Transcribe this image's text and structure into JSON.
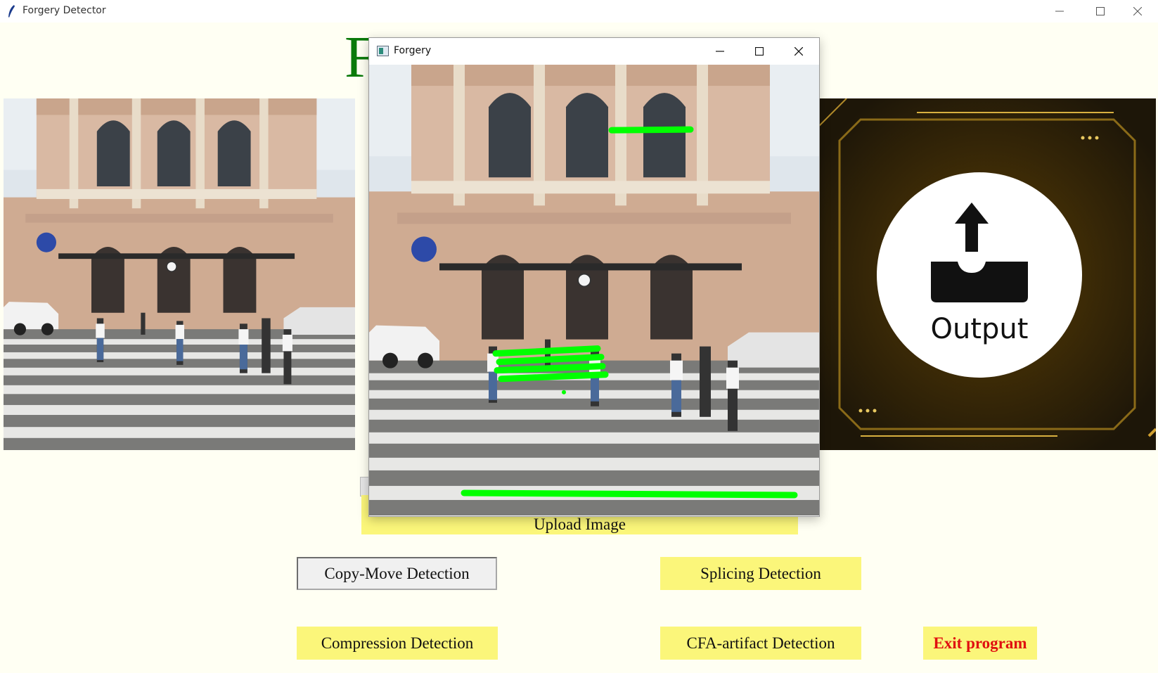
{
  "window": {
    "title": "Forgery Detector"
  },
  "heading": {
    "visible_letter": "F"
  },
  "output_panel": {
    "label": "Output"
  },
  "popup": {
    "title": "Forgery"
  },
  "buttons": {
    "upload": "Upload Image",
    "copy_move": "Copy-Move Detection",
    "splicing": "Splicing Detection",
    "compression": "Compression Detection",
    "cfa": "CFA-artifact Detection",
    "exit": "Exit program"
  },
  "colors": {
    "background": "#fffff3",
    "button_yellow": "#fbf67a",
    "exit_text": "#e01010",
    "heading_green": "#0a7a0a",
    "forgery_marks": "#00ff00"
  },
  "icons": [
    "feather-icon",
    "minimize-icon",
    "maximize-icon",
    "close-icon",
    "upload-tray-icon"
  ]
}
